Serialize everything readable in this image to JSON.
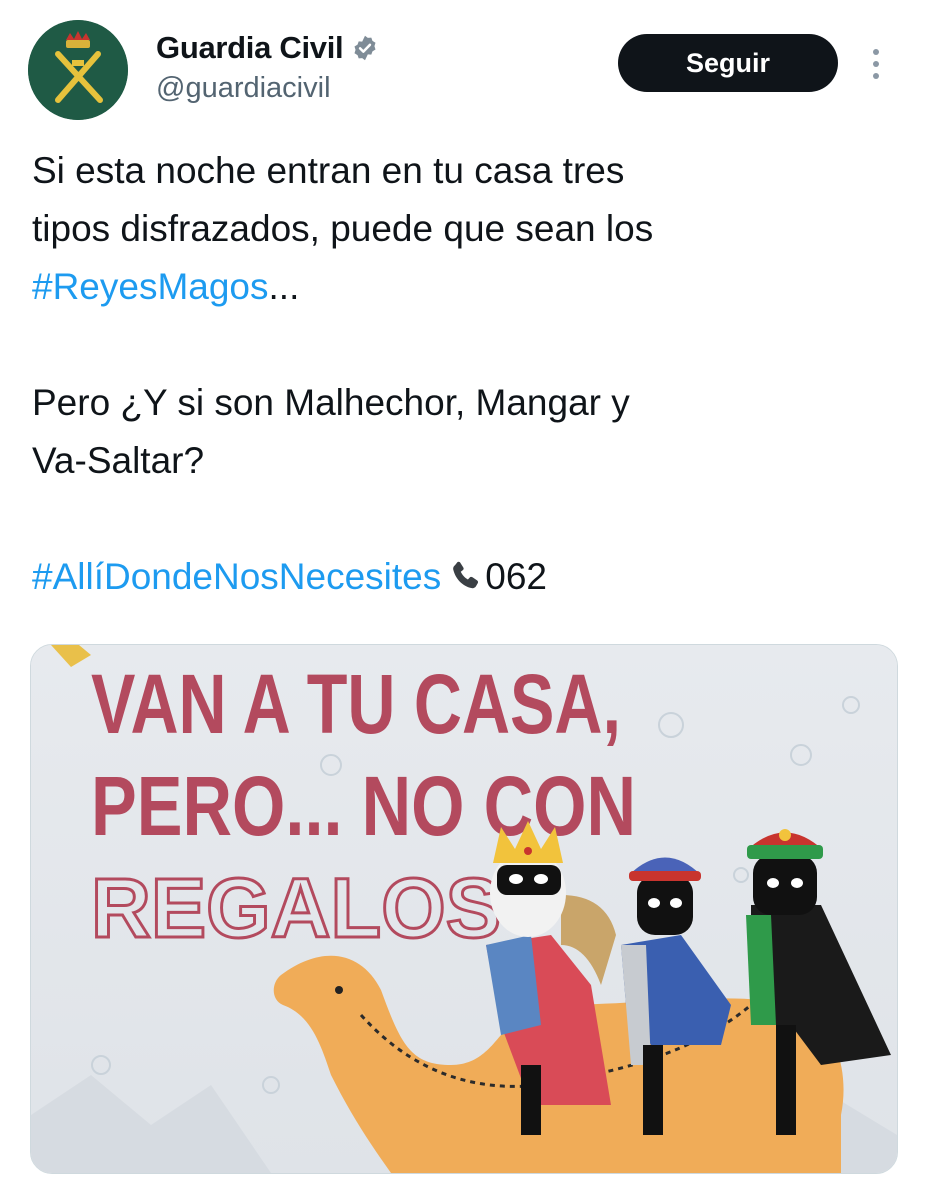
{
  "account": {
    "display_name": "Guardia Civil",
    "handle": "@guardiacivil",
    "verified": true,
    "avatar_icon": "guardia-civil-emblem-icon",
    "avatar_color": "#1f5a45"
  },
  "actions": {
    "follow_label": "Seguir",
    "more_icon": "more-vertical-icon"
  },
  "tweet": {
    "line1": "Si esta noche entran en tu casa tres",
    "line2": "tipos disfrazados, puede que sean los",
    "hashtag1": "#ReyesMagos",
    "ellipsis": "...",
    "line4": "Pero ¿Y si son Malhechor, Mangar y",
    "line5": "Va-Saltar?",
    "hashtag2": "#AllíDondeNosNecesites",
    "phone_icon": "telephone-icon",
    "phone_number": "062"
  },
  "media": {
    "poster_line1": "VAN A TU CASA,",
    "poster_line2": "PERO... NO CON",
    "poster_line3": "REGALOS"
  },
  "colors": {
    "hashtag": "#1d9bf0",
    "button_bg": "#0f1419",
    "handle": "#536471",
    "poster_text": "#b34a5e"
  }
}
